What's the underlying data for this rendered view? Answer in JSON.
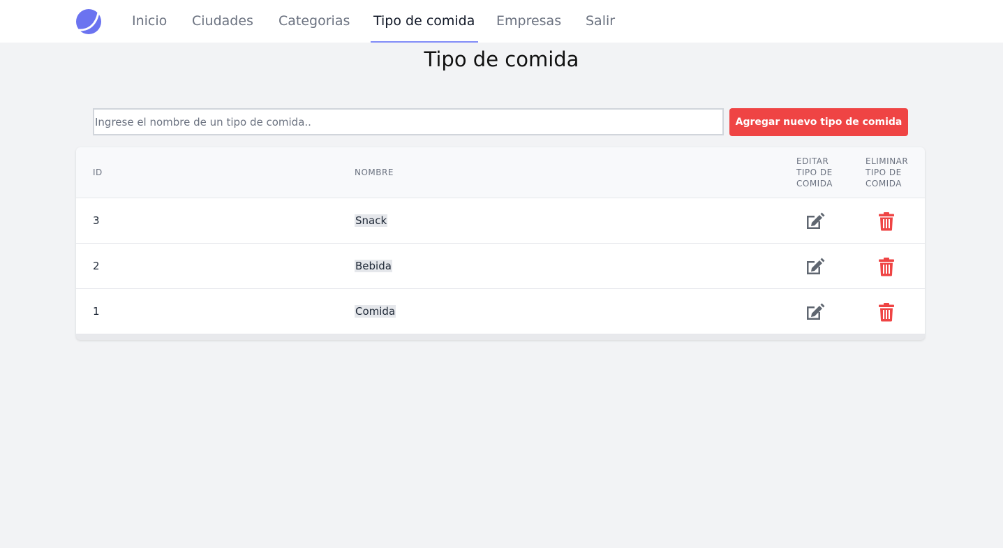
{
  "nav": {
    "items": [
      {
        "label": "Inicio"
      },
      {
        "label": "Ciudades"
      },
      {
        "label": "Categorias"
      },
      {
        "label": "Tipo de comida",
        "active": true
      },
      {
        "label": "Empresas"
      },
      {
        "label": "Salir"
      }
    ]
  },
  "page": {
    "title": "Tipo de comida"
  },
  "form": {
    "placeholder": "Ingrese el nombre de un tipo de comida..",
    "value": "",
    "add_label": "Agregar nuevo tipo de comida"
  },
  "table": {
    "headers": {
      "id": "ID",
      "name": "NOMBRE",
      "edit": "EDITAR TIPO DE COMIDA",
      "delete": "ELIMINAR TIPO DE COMIDA"
    },
    "rows": [
      {
        "id": "3",
        "name": "Snack"
      },
      {
        "id": "2",
        "name": "Bebida"
      },
      {
        "id": "1",
        "name": "Comida"
      }
    ]
  },
  "icons": {
    "logo": "logo-icon",
    "edit": "edit-icon",
    "delete": "trash-icon"
  },
  "colors": {
    "accent": "#818cf8",
    "danger": "#ef4444",
    "edit_icon": "#5f6670",
    "logo": "#6366f1"
  }
}
